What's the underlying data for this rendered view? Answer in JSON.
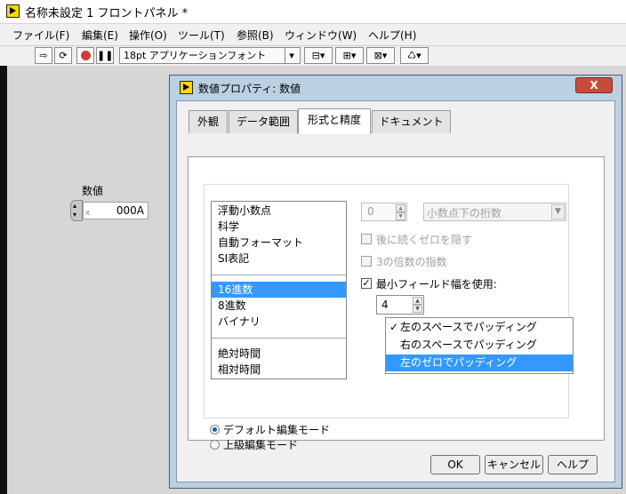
{
  "window": {
    "title": "名称未設定 1 フロントパネル *"
  },
  "menubar": {
    "items": [
      "ファイル(F)",
      "編集(E)",
      "操作(O)",
      "ツール(T)",
      "参照(B)",
      "ウィンドウ(W)",
      "ヘルプ(H)"
    ]
  },
  "toolbar": {
    "font_select": "18pt アプリケーションフォント"
  },
  "front_panel": {
    "control_label": "数値",
    "control_value": "000A"
  },
  "dialog": {
    "title": "数値プロパティ: 数値",
    "close_label": "X",
    "tabs": [
      "外観",
      "データ範囲",
      "形式と精度",
      "ドキュメント"
    ],
    "active_tab": "形式と精度",
    "format_groups": [
      [
        "浮動小数点",
        "科学",
        "自動フォーマット",
        "SI表記"
      ],
      [
        "16進数",
        "8進数",
        "バイナリ"
      ],
      [
        "絶対時間",
        "相対時間"
      ]
    ],
    "selected_format": "16進数",
    "digits_value": "0",
    "digits_mode": "小数点下の桁数",
    "hide_trailing_zeros": {
      "label": "後に続くゼロを隠す",
      "checked": false,
      "enabled": false
    },
    "exponent_multiple_3": {
      "label": "3の倍数の指数",
      "checked": false,
      "enabled": false
    },
    "min_field_width": {
      "label": "最小フィールド幅を使用:",
      "checked": true,
      "value": "4"
    },
    "padding_options": [
      "左のスペースでパッディング",
      "右のスペースでパッディング",
      "左のゼロでパッディング"
    ],
    "padding_checked": "左のスペースでパッディング",
    "padding_selected": "左のゼロでパッディング",
    "edit_modes": [
      "デフォルト編集モード",
      "上級編集モード"
    ],
    "edit_mode_selected": "デフォルト編集モード",
    "buttons": {
      "ok": "OK",
      "cancel": "キャンセル",
      "help": "ヘルプ"
    }
  }
}
